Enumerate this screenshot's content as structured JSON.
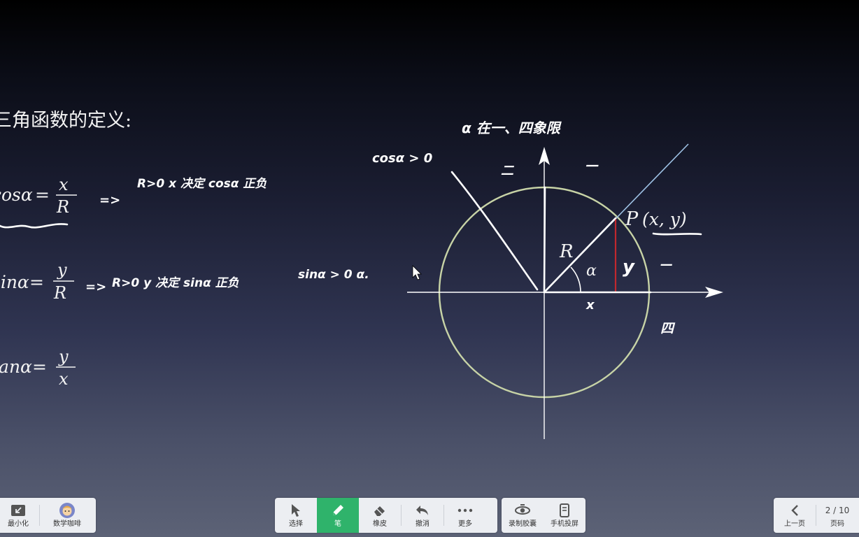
{
  "slide": {
    "heading": "三角函数的定义:",
    "cos_lhs": "cosα",
    "sin_lhs": "sinα",
    "tan_lhs": "tanα",
    "frac_x": "x",
    "frac_y": "y",
    "frac_R": "R",
    "eq": "=",
    "point_label": "P",
    "point_coords": "(x, y)",
    "radius_label": "R",
    "angle_label": "α"
  },
  "handwriting": {
    "cos_note": "R>0   x 决定 cosα 正负",
    "sin_note": "R>0   y 决定 sinα 正负",
    "cos_cond": "cosα > 0",
    "alpha_quadrants": "α 在一、四象限",
    "sin_cond": "sinα > 0    α.",
    "implies": "=>",
    "quadrant_1": "一",
    "quadrant_2": "二",
    "quadrant_4": "四",
    "side_x": "x",
    "side_y": "y",
    "dash": "—"
  },
  "toolbar_left": {
    "minimize": "最小化",
    "coffee": "数学咖啡"
  },
  "toolbar_center": {
    "select": "选择",
    "pen": "笔",
    "eraser": "橡皮",
    "undo": "撤消",
    "more": "更多"
  },
  "toolbar_record": {
    "record": "录制胶囊",
    "phone": "手机投屏"
  },
  "pager": {
    "prev": "上一页",
    "page_indicator": "2 / 10",
    "page_label": "页码"
  },
  "colors": {
    "pen_active": "#2fb36b",
    "circle": "#c7d3a6",
    "ray": "#9fc3e6",
    "red_segment": "#c0282e"
  }
}
